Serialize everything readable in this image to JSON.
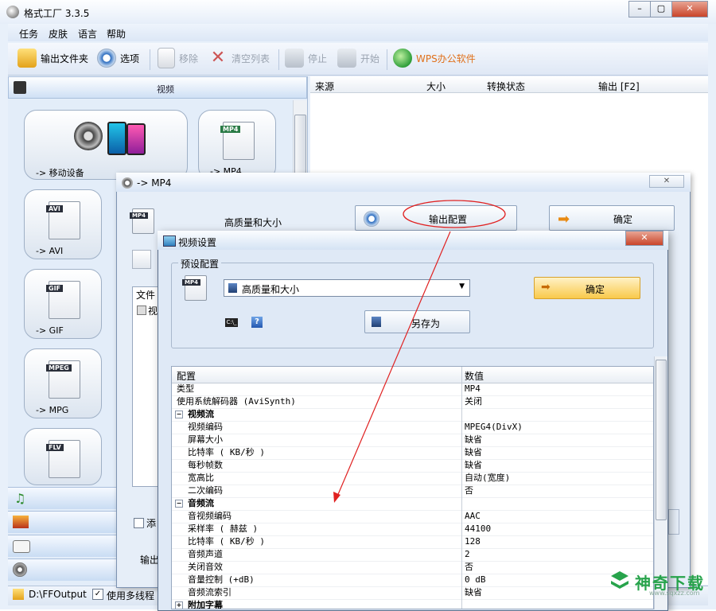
{
  "app": {
    "title": "格式工厂 3.3.5"
  },
  "menu": [
    "任务",
    "皮肤",
    "语言",
    "帮助"
  ],
  "toolbar": {
    "output_folder": "输出文件夹",
    "options": "选项",
    "remove": "移除",
    "clear_list": "清空列表",
    "stop": "停止",
    "start": "开始",
    "wps": "WPS办公软件"
  },
  "category": {
    "video": "视频"
  },
  "tiles": [
    {
      "label": "-> 移动设备"
    },
    {
      "label": "-> MP4",
      "tag": "MP4"
    },
    {
      "label": "-> AVI",
      "tag": "AVI"
    },
    {
      "label": "-> GIF",
      "tag": "GIF"
    },
    {
      "label": "-> MPG",
      "tag": "MPEG"
    },
    {
      "label": "",
      "tag": "FLV"
    }
  ],
  "list_columns": [
    "来源",
    "大小",
    "转换状态",
    "输出 [F2]"
  ],
  "status": {
    "path": "D:\\FFOutput",
    "multithread": "使用多线程"
  },
  "mp4_dialog": {
    "title": "-> MP4",
    "profile": "高质量和大小",
    "output_config": "输出配置",
    "ok": "确定",
    "files_label": "文件",
    "add_label": "添",
    "output_label": "输出",
    "file_prefix": "视"
  },
  "video_dialog": {
    "title": "视频设置",
    "preset_group": "预设配置",
    "preset_value": "高质量和大小",
    "ok": "确定",
    "save_as": "另存为",
    "cmd_label": "C:\\_",
    "help_label": "?",
    "col_key": "配置",
    "col_value": "数值",
    "rows": [
      {
        "k": "类型",
        "v": "MP4",
        "type": "item",
        "indent": 0
      },
      {
        "k": "使用系统解码器 (AviSynth)",
        "v": "关闭",
        "type": "item",
        "indent": 0
      },
      {
        "k": "视频流",
        "v": "",
        "type": "section",
        "sign": "−"
      },
      {
        "k": "视频编码",
        "v": "MPEG4(DivX)",
        "type": "item",
        "indent": 1
      },
      {
        "k": "屏幕大小",
        "v": "缺省",
        "type": "item",
        "indent": 1
      },
      {
        "k": "比特率 ( KB/秒 )",
        "v": "缺省",
        "type": "item",
        "indent": 1
      },
      {
        "k": "每秒帧数",
        "v": "缺省",
        "type": "item",
        "indent": 1
      },
      {
        "k": "宽高比",
        "v": "自动(宽度)",
        "type": "item",
        "indent": 1
      },
      {
        "k": "二次编码",
        "v": "否",
        "type": "item",
        "indent": 1
      },
      {
        "k": "音频流",
        "v": "",
        "type": "section",
        "sign": "−"
      },
      {
        "k": "音视频编码",
        "v": "AAC",
        "type": "item",
        "indent": 1
      },
      {
        "k": "采样率 ( 赫兹 )",
        "v": "44100",
        "type": "item",
        "indent": 1
      },
      {
        "k": "比特率 ( KB/秒 )",
        "v": "128",
        "type": "item",
        "indent": 1
      },
      {
        "k": "音频声道",
        "v": "2",
        "type": "item",
        "indent": 1
      },
      {
        "k": "关闭音效",
        "v": "否",
        "type": "item",
        "indent": 1
      },
      {
        "k": "音量控制 (+dB)",
        "v": "0 dB",
        "type": "item",
        "indent": 1
      },
      {
        "k": "音频流索引",
        "v": "缺省",
        "type": "item",
        "indent": 1
      },
      {
        "k": "附加字幕",
        "v": "",
        "type": "section",
        "sign": "+"
      }
    ]
  },
  "watermark": {
    "brand": "神奇下载",
    "site": "www.sqxzz.com"
  },
  "colors": {
    "accent_red": "#e02020",
    "title_bg": "#dce7f6"
  }
}
